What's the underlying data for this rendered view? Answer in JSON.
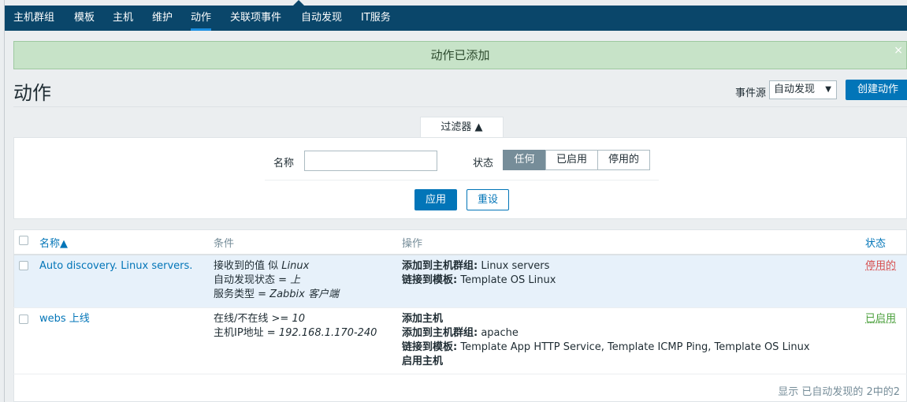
{
  "nav": {
    "tabs": [
      "主机群组",
      "模板",
      "主机",
      "维护",
      "动作",
      "关联项事件",
      "自动发现",
      "IT服务"
    ],
    "active_tab": "动作"
  },
  "message": {
    "text": "动作已添加",
    "close": "×"
  },
  "page": {
    "title": "动作",
    "event_source_label": "事件源",
    "event_source_value": "自动发现",
    "create_button": "创建动作"
  },
  "filter": {
    "tab_label": "过滤器 ▲",
    "name_label": "名称",
    "name_value": "",
    "status_label": "状态",
    "status_options": [
      "任何",
      "已启用",
      "停用的"
    ],
    "status_selected": "任何",
    "apply_button": "应用",
    "reset_button": "重设"
  },
  "table": {
    "headers": {
      "name": "名称▲",
      "conditions": "条件",
      "operations": "操作",
      "status": "状态"
    },
    "rows": [
      {
        "name": "Auto discovery. Linux servers.",
        "conditions": [
          {
            "plain": "接收到的值 似 ",
            "italic": "Linux"
          },
          {
            "plain": "自动发现状态 = ",
            "italic": "上"
          },
          {
            "plain": "服务类型 = ",
            "italic": "Zabbix 客户端"
          }
        ],
        "operations": [
          {
            "bold": "添加到主机群组:",
            "plain": " Linux servers"
          },
          {
            "bold": "链接到模板:",
            "plain": " Template OS Linux"
          }
        ],
        "status": "停用的"
      },
      {
        "name": "webs 上线",
        "conditions": [
          {
            "plain": "在线/不在线 >= ",
            "italic": "10"
          },
          {
            "plain": "主机IP地址 = ",
            "italic": "192.168.1.170-240"
          }
        ],
        "operations": [
          {
            "bold": "添加主机",
            "plain": ""
          },
          {
            "bold": "添加到主机群组:",
            "plain": " apache"
          },
          {
            "bold": "链接到模板:",
            "plain": " Template App HTTP Service, Template ICMP Ping, Template OS Linux"
          },
          {
            "bold": "启用主机",
            "plain": ""
          }
        ],
        "status": "已启用"
      }
    ],
    "footer": "显示 已自动发现的 2中的2"
  },
  "colors": {
    "nav_bg": "#0a466a",
    "primary": "#0275b8",
    "success_bg": "#c7e3c8",
    "disabled_red": "#d64e4e",
    "enabled_green": "#4a9f3b"
  }
}
